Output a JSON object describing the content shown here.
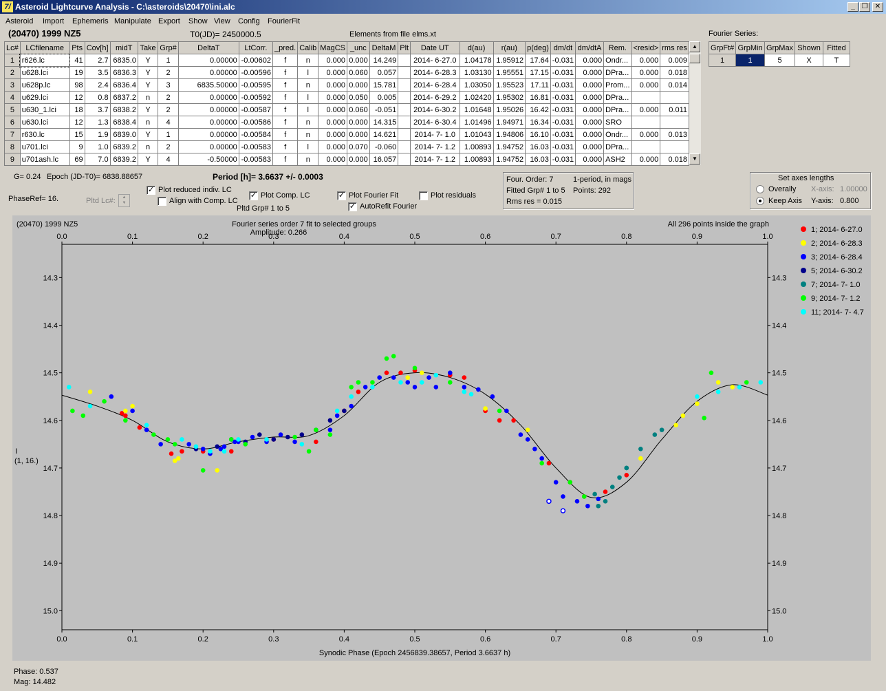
{
  "window": {
    "title": "Asteroid Lightcurve Analysis - C:\\asteroids\\20470\\ini.alc",
    "icon_text": "7/"
  },
  "menu": [
    "Asteroid",
    "Import",
    "Ephemeris",
    "Manipulate",
    "Export",
    "Show",
    "View",
    "Config",
    "FourierFit"
  ],
  "header": {
    "asteroid": "(20470) 1999 NZ5",
    "t0": "T0(JD)= 2450000.5",
    "elements": "Elements from file elms.xt"
  },
  "table": {
    "columns": [
      "Lc#",
      "LCfilename",
      "Pts",
      "Cov[h]",
      "midT",
      "Take",
      "Grp#",
      "DeltaT",
      "LtCorr.",
      "_pred.",
      "Calib",
      "MagCS",
      "_unc",
      "DeltaM",
      "Plt",
      "Date UT",
      "d(au)",
      "r(au)",
      "p(deg)",
      "dm/dt",
      "dm/dtA",
      "Rem.",
      "<resid>",
      "rms res"
    ],
    "rows": [
      [
        "1",
        "r626.lc",
        "41",
        "2.7",
        "6835.0",
        "Y",
        "1",
        "0.00000",
        "-0.00602",
        "f",
        "n",
        "0.000",
        "0.000",
        "14.249",
        "",
        "2014- 6-27.0",
        "1.04178",
        "1.95912",
        "17.64",
        "-0.031",
        "0.000",
        "Ondr...",
        "0.000",
        "0.009"
      ],
      [
        "2",
        "u628.lci",
        "19",
        "3.5",
        "6836.3",
        "Y",
        "2",
        "0.00000",
        "-0.00596",
        "f",
        "l",
        "0.000",
        "0.060",
        "0.057",
        "",
        "2014- 6-28.3",
        "1.03130",
        "1.95551",
        "17.15",
        "-0.031",
        "0.000",
        "DPra...",
        "0.000",
        "0.018"
      ],
      [
        "3",
        "u628p.lc",
        "98",
        "2.4",
        "6836.4",
        "Y",
        "3",
        "6835.50000",
        "-0.00595",
        "f",
        "n",
        "0.000",
        "0.000",
        "15.781",
        "",
        "2014- 6-28.4",
        "1.03050",
        "1.95523",
        "17.11",
        "-0.031",
        "0.000",
        "Prom...",
        "0.000",
        "0.014"
      ],
      [
        "4",
        "u629.lci",
        "12",
        "0.8",
        "6837.2",
        "n",
        "2",
        "0.00000",
        "-0.00592",
        "f",
        "l",
        "0.000",
        "0.050",
        "0.005",
        "",
        "2014- 6-29.2",
        "1.02420",
        "1.95302",
        "16.81",
        "-0.031",
        "0.000",
        "DPra...",
        "",
        ""
      ],
      [
        "5",
        "u630_1.lci",
        "18",
        "3.7",
        "6838.2",
        "Y",
        "2",
        "0.00000",
        "-0.00587",
        "f",
        "l",
        "0.000",
        "0.060",
        "-0.051",
        "",
        "2014- 6-30.2",
        "1.01648",
        "1.95026",
        "16.42",
        "-0.031",
        "0.000",
        "DPra...",
        "0.000",
        "0.011"
      ],
      [
        "6",
        "u630.lci",
        "12",
        "1.3",
        "6838.4",
        "n",
        "4",
        "0.00000",
        "-0.00586",
        "f",
        "n",
        "0.000",
        "0.000",
        "14.315",
        "",
        "2014- 6-30.4",
        "1.01496",
        "1.94971",
        "16.34",
        "-0.031",
        "0.000",
        "SRO",
        "",
        ""
      ],
      [
        "7",
        "r630.lc",
        "15",
        "1.9",
        "6839.0",
        "Y",
        "1",
        "0.00000",
        "-0.00584",
        "f",
        "n",
        "0.000",
        "0.000",
        "14.621",
        "",
        "2014- 7- 1.0",
        "1.01043",
        "1.94806",
        "16.10",
        "-0.031",
        "0.000",
        "Ondr...",
        "0.000",
        "0.013"
      ],
      [
        "8",
        "u701.lci",
        "9",
        "1.0",
        "6839.2",
        "n",
        "2",
        "0.00000",
        "-0.00583",
        "f",
        "l",
        "0.000",
        "0.070",
        "-0.060",
        "",
        "2014- 7- 1.2",
        "1.00893",
        "1.94752",
        "16.03",
        "-0.031",
        "0.000",
        "DPra...",
        "",
        ""
      ],
      [
        "9",
        "u701ash.lc",
        "69",
        "7.0",
        "6839.2",
        "Y",
        "4",
        "-0.50000",
        "-0.00583",
        "f",
        "n",
        "0.000",
        "0.000",
        "16.057",
        "",
        "2014- 7- 1.2",
        "1.00893",
        "1.94752",
        "16.03",
        "-0.031",
        "0.000",
        "ASH2",
        "0.000",
        "0.018"
      ]
    ]
  },
  "fourier_table": {
    "title": "Fourier Series:",
    "columns": [
      "GrpFt#",
      "GrpMin",
      "GrpMax",
      "Shown",
      "Fitted"
    ],
    "row": [
      "1",
      "1",
      "5",
      "X",
      "T"
    ]
  },
  "info": {
    "g": "G= 0.24",
    "epoch": "Epoch (JD-T0)= 6838.88657",
    "period": "Period [h]= 3.6637 +/- 0.0003",
    "phaseref": "PhaseRef= 16.",
    "pltd_lc": "Pltd Lc#:",
    "pltd_grp": "Pltd Grp#  1   to   5"
  },
  "checks": {
    "plot_reduced": {
      "label": "Plot reduced indiv. LC",
      "checked": true
    },
    "align_comp": {
      "label": "Align with Comp. LC",
      "checked": false
    },
    "plot_comp": {
      "label": "Plot Comp. LC",
      "checked": true
    },
    "plot_fourier": {
      "label": "Plot Fourier Fit",
      "checked": true
    },
    "autorefit": {
      "label": "AutoRefit Fourier",
      "checked": true
    },
    "plot_residuals": {
      "label": "Plot residuals",
      "checked": false
    }
  },
  "fourier_info": {
    "order": "Four. Order:  7",
    "period_mode": "1-period, in mags",
    "fitted": "Fitted Grp# 1 to 5",
    "points": "Points: 292",
    "rms": "Rms res     = 0.015"
  },
  "axes_box": {
    "title": "Set axes lengths",
    "overally": "Overally",
    "keep_axis": "Keep Axis",
    "x_label": "X-axis:",
    "x_val": "1.00000",
    "y_label": "Y-axis:",
    "y_val": "0.800"
  },
  "plot": {
    "top_left": "(20470) 1999 NZ5",
    "title": "Fourier series order 7 fit to selected groups",
    "amplitude": "Amplitude: 0.266",
    "points_note": "All 296 points inside the graph",
    "y_axis_label": "I",
    "y_axis_sub": "(1, 16.)",
    "x_axis_label": "Synodic Phase (Epoch 2456839.38657, Period 3.6637 h)"
  },
  "status": {
    "phase": "Phase:  0.537",
    "mag": "Mag:    14.482"
  },
  "chart_data": {
    "type": "scatter",
    "xlim": [
      0.0,
      1.0
    ],
    "ylim": [
      14.23,
      15.04
    ],
    "y_inverted": true,
    "x_ticks": [
      "0.0",
      "0.1",
      "0.2",
      "0.3",
      "0.4",
      "0.5",
      "0.6",
      "0.7",
      "0.8",
      "0.9",
      "1.0"
    ],
    "y_ticks": [
      "14.3",
      "14.4",
      "14.5",
      "14.6",
      "14.7",
      "14.8",
      "14.9",
      "15.0"
    ],
    "fourier_curve": [
      [
        0.0,
        14.547
      ],
      [
        0.05,
        14.57
      ],
      [
        0.1,
        14.6
      ],
      [
        0.15,
        14.645
      ],
      [
        0.2,
        14.66
      ],
      [
        0.25,
        14.645
      ],
      [
        0.3,
        14.635
      ],
      [
        0.35,
        14.632
      ],
      [
        0.4,
        14.59
      ],
      [
        0.45,
        14.52
      ],
      [
        0.5,
        14.5
      ],
      [
        0.55,
        14.51
      ],
      [
        0.6,
        14.545
      ],
      [
        0.65,
        14.61
      ],
      [
        0.7,
        14.7
      ],
      [
        0.75,
        14.762
      ],
      [
        0.8,
        14.73
      ],
      [
        0.85,
        14.64
      ],
      [
        0.9,
        14.56
      ],
      [
        0.95,
        14.525
      ],
      [
        1.0,
        14.547
      ]
    ],
    "series": [
      {
        "name": "1; 2014- 6-27.0",
        "color": "#ff0000",
        "points": [
          [
            0.155,
            14.67
          ],
          [
            0.17,
            14.665
          ],
          [
            0.2,
            14.665
          ],
          [
            0.24,
            14.665
          ],
          [
            0.46,
            14.5
          ],
          [
            0.48,
            14.5
          ],
          [
            0.55,
            14.505
          ],
          [
            0.57,
            14.51
          ],
          [
            0.62,
            14.6
          ],
          [
            0.64,
            14.6
          ],
          [
            0.69,
            14.69
          ],
          [
            0.72,
            14.73
          ],
          [
            0.74,
            14.76
          ],
          [
            0.77,
            14.75
          ],
          [
            0.8,
            14.715
          ],
          [
            0.3,
            14.64
          ],
          [
            0.36,
            14.645
          ],
          [
            0.4,
            14.58
          ],
          [
            0.42,
            14.54
          ],
          [
            0.085,
            14.585
          ],
          [
            0.09,
            14.59
          ],
          [
            0.11,
            14.615
          ],
          [
            0.5,
            14.495
          ],
          [
            0.6,
            14.58
          ]
        ]
      },
      {
        "name": "2; 2014- 6-28.3",
        "color": "#ffff00",
        "points": [
          [
            0.04,
            14.54
          ],
          [
            0.09,
            14.58
          ],
          [
            0.1,
            14.57
          ],
          [
            0.165,
            14.68
          ],
          [
            0.22,
            14.705
          ],
          [
            0.16,
            14.685
          ],
          [
            0.49,
            14.51
          ],
          [
            0.51,
            14.5
          ],
          [
            0.6,
            14.575
          ],
          [
            0.66,
            14.62
          ],
          [
            0.82,
            14.68
          ],
          [
            0.87,
            14.61
          ],
          [
            0.88,
            14.59
          ],
          [
            0.9,
            14.565
          ],
          [
            0.93,
            14.52
          ],
          [
            0.95,
            14.53
          ]
        ]
      },
      {
        "name": "3; 2014- 6-28.4",
        "color": "#0000ff",
        "points": [
          [
            0.07,
            14.55
          ],
          [
            0.1,
            14.58
          ],
          [
            0.12,
            14.62
          ],
          [
            0.14,
            14.65
          ],
          [
            0.18,
            14.65
          ],
          [
            0.2,
            14.66
          ],
          [
            0.21,
            14.67
          ],
          [
            0.23,
            14.655
          ],
          [
            0.25,
            14.645
          ],
          [
            0.27,
            14.635
          ],
          [
            0.29,
            14.645
          ],
          [
            0.31,
            14.63
          ],
          [
            0.33,
            14.645
          ],
          [
            0.38,
            14.62
          ],
          [
            0.39,
            14.59
          ],
          [
            0.41,
            14.57
          ],
          [
            0.43,
            14.53
          ],
          [
            0.45,
            14.51
          ],
          [
            0.47,
            14.51
          ],
          [
            0.49,
            14.52
          ],
          [
            0.5,
            14.53
          ],
          [
            0.52,
            14.51
          ],
          [
            0.53,
            14.53
          ],
          [
            0.55,
            14.5
          ],
          [
            0.57,
            14.53
          ],
          [
            0.59,
            14.535
          ],
          [
            0.61,
            14.55
          ],
          [
            0.63,
            14.58
          ],
          [
            0.65,
            14.63
          ],
          [
            0.66,
            14.64
          ],
          [
            0.67,
            14.66
          ],
          [
            0.68,
            14.68
          ],
          [
            0.7,
            14.73
          ],
          [
            0.71,
            14.76
          ],
          [
            0.73,
            14.77
          ],
          [
            0.745,
            14.78
          ],
          [
            0.76,
            14.765
          ],
          [
            0.225,
            14.66
          ],
          [
            0.245,
            14.645
          ]
        ]
      },
      {
        "name": "5; 2014- 6-30.2",
        "color": "#00008b",
        "points": [
          [
            0.19,
            14.66
          ],
          [
            0.22,
            14.655
          ],
          [
            0.24,
            14.64
          ],
          [
            0.26,
            14.645
          ],
          [
            0.28,
            14.63
          ],
          [
            0.3,
            14.64
          ],
          [
            0.32,
            14.635
          ],
          [
            0.34,
            14.63
          ],
          [
            0.36,
            14.62
          ],
          [
            0.38,
            14.6
          ],
          [
            0.4,
            14.58
          ]
        ]
      },
      {
        "name": "7; 2014- 7- 1.0",
        "color": "#008080",
        "points": [
          [
            0.78,
            14.74
          ],
          [
            0.79,
            14.72
          ],
          [
            0.8,
            14.7
          ],
          [
            0.82,
            14.66
          ],
          [
            0.84,
            14.63
          ],
          [
            0.85,
            14.62
          ],
          [
            0.755,
            14.755
          ],
          [
            0.77,
            14.77
          ],
          [
            0.76,
            14.78
          ],
          [
            0.8,
            14.7
          ]
        ]
      },
      {
        "name": "9; 2014- 7- 1.2",
        "color": "#00ff00",
        "points": [
          [
            0.015,
            14.58
          ],
          [
            0.03,
            14.59
          ],
          [
            0.06,
            14.56
          ],
          [
            0.09,
            14.6
          ],
          [
            0.13,
            14.63
          ],
          [
            0.15,
            14.64
          ],
          [
            0.16,
            14.65
          ],
          [
            0.2,
            14.705
          ],
          [
            0.24,
            14.64
          ],
          [
            0.26,
            14.65
          ],
          [
            0.33,
            14.635
          ],
          [
            0.35,
            14.665
          ],
          [
            0.41,
            14.53
          ],
          [
            0.42,
            14.52
          ],
          [
            0.44,
            14.52
          ],
          [
            0.46,
            14.47
          ],
          [
            0.47,
            14.465
          ],
          [
            0.5,
            14.49
          ],
          [
            0.55,
            14.52
          ],
          [
            0.62,
            14.58
          ],
          [
            0.68,
            14.69
          ],
          [
            0.72,
            14.73
          ],
          [
            0.74,
            14.76
          ],
          [
            0.91,
            14.595
          ],
          [
            0.92,
            14.5
          ],
          [
            0.97,
            14.52
          ],
          [
            0.36,
            14.62
          ],
          [
            0.38,
            14.63
          ]
        ]
      },
      {
        "name": "11; 2014- 7- 4.7",
        "color": "#00ffff",
        "points": [
          [
            0.01,
            14.53
          ],
          [
            0.04,
            14.57
          ],
          [
            0.12,
            14.61
          ],
          [
            0.17,
            14.64
          ],
          [
            0.19,
            14.655
          ],
          [
            0.21,
            14.665
          ],
          [
            0.23,
            14.665
          ],
          [
            0.25,
            14.64
          ],
          [
            0.29,
            14.64
          ],
          [
            0.34,
            14.65
          ],
          [
            0.39,
            14.58
          ],
          [
            0.41,
            14.55
          ],
          [
            0.44,
            14.53
          ],
          [
            0.48,
            14.52
          ],
          [
            0.51,
            14.52
          ],
          [
            0.53,
            14.505
          ],
          [
            0.57,
            14.54
          ],
          [
            0.58,
            14.545
          ],
          [
            0.9,
            14.55
          ],
          [
            0.93,
            14.54
          ],
          [
            0.96,
            14.53
          ],
          [
            0.99,
            14.52
          ]
        ]
      }
    ],
    "outliers": [
      [
        0.69,
        14.77
      ],
      [
        0.71,
        14.79
      ]
    ]
  },
  "colors": {
    "titlebar": "#0a246a",
    "plot_bg": "#c0c0c0",
    "fourier_selected": "#0a246a"
  }
}
